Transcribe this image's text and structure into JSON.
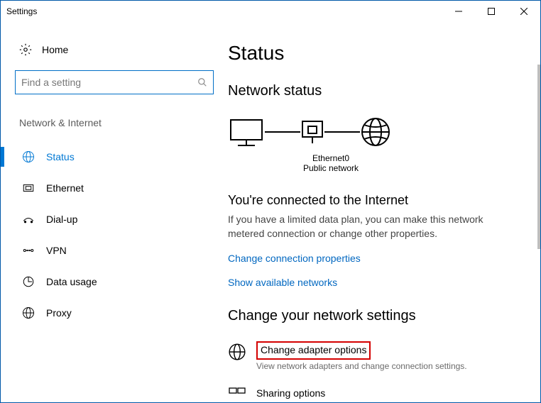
{
  "window": {
    "title": "Settings"
  },
  "sidebar": {
    "home": "Home",
    "search_placeholder": "Find a setting",
    "section": "Network & Internet",
    "items": [
      {
        "label": "Status"
      },
      {
        "label": "Ethernet"
      },
      {
        "label": "Dial-up"
      },
      {
        "label": "VPN"
      },
      {
        "label": "Data usage"
      },
      {
        "label": "Proxy"
      }
    ]
  },
  "main": {
    "title": "Status",
    "network_status_heading": "Network status",
    "adapter_name": "Ethernet0",
    "network_type": "Public network",
    "connected_heading": "You're connected to the Internet",
    "connected_desc": "If you have a limited data plan, you can make this network metered connection or change other properties.",
    "link_change_props": "Change connection properties",
    "link_show_networks": "Show available networks",
    "change_settings_heading": "Change your network settings",
    "adapter_options": {
      "title": "Change adapter options",
      "sub": "View network adapters and change connection settings."
    },
    "sharing_options": {
      "title": "Sharing options"
    }
  }
}
